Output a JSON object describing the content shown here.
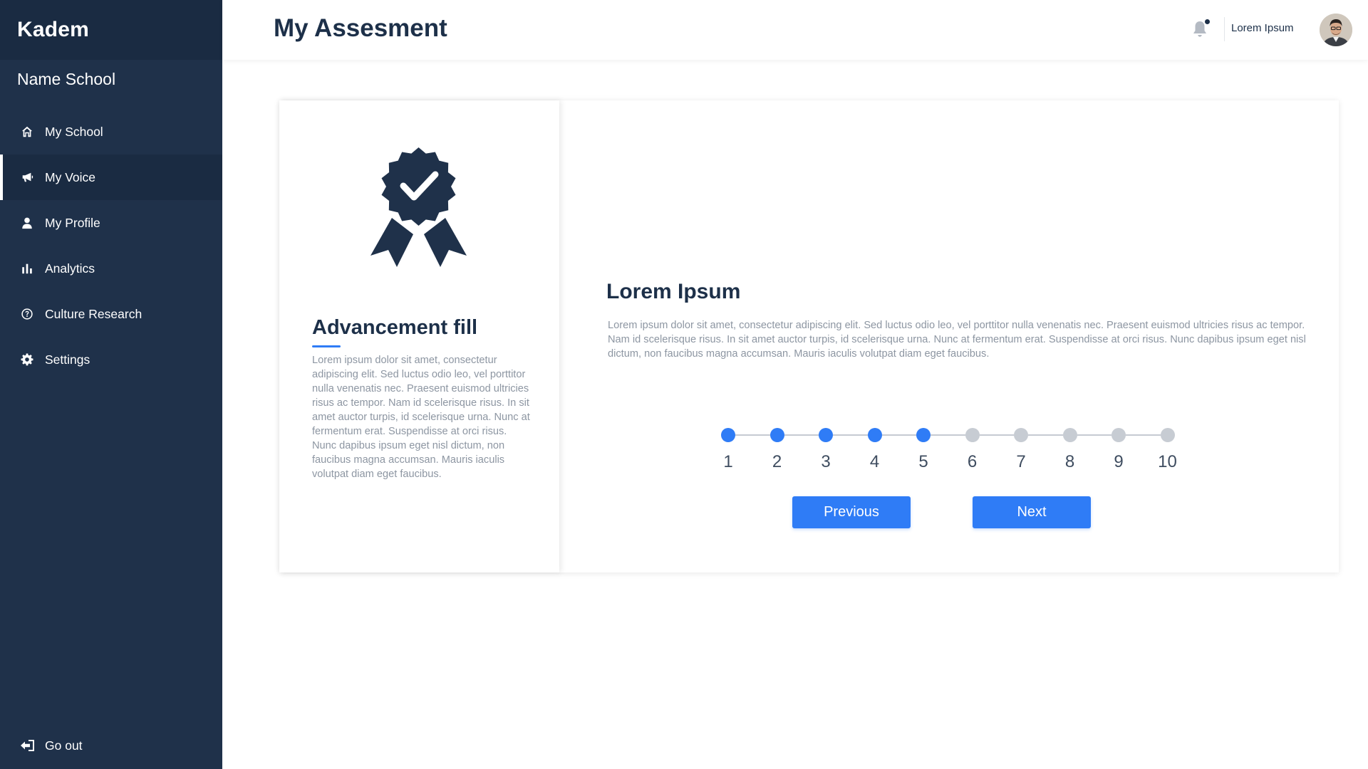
{
  "sidebar": {
    "brand": "Kadem",
    "school": "Name School",
    "items": [
      {
        "label": "My School",
        "icon": "home-icon",
        "active": false
      },
      {
        "label": "My Voice",
        "icon": "megaphone-icon",
        "active": true
      },
      {
        "label": "My Profile",
        "icon": "user-icon",
        "active": false
      },
      {
        "label": "Analytics",
        "icon": "bar-chart-icon",
        "active": false
      },
      {
        "label": "Culture Research",
        "icon": "question-circle-icon",
        "active": false
      },
      {
        "label": "Settings",
        "icon": "gear-icon",
        "active": false
      }
    ],
    "logout": {
      "label": "Go out",
      "icon": "logout-icon"
    }
  },
  "header": {
    "title": "My Assesment",
    "username": "Lorem Ipsum",
    "notification_icon": "bell-icon"
  },
  "left_panel": {
    "icon": "award-badge-check-icon",
    "title": "Advancement fill",
    "text": "Lorem ipsum dolor sit amet, consectetur adipiscing elit. Sed luctus odio leo, vel porttitor nulla venenatis nec. Praesent euismod ultricies risus ac tempor. Nam id scelerisque risus. In sit amet auctor turpis, id scelerisque urna. Nunc at fermentum erat. Suspendisse at orci risus. Nunc dapibus ipsum eget nisl dictum, non faucibus magna accumsan. Mauris iaculis volutpat diam eget faucibus."
  },
  "main": {
    "title": "Lorem Ipsum",
    "text": "Lorem ipsum dolor sit amet, consectetur adipiscing elit. Sed luctus odio leo, vel porttitor nulla venenatis nec. Praesent euismod ultricies risus ac tempor. Nam id scelerisque risus. In sit amet auctor turpis, id scelerisque urna. Nunc at fermentum erat. Suspendisse at orci risus. Nunc dapibus ipsum eget nisl dictum, non faucibus magna accumsan. Mauris iaculis volutpat diam eget faucibus."
  },
  "stepper": {
    "steps": [
      "1",
      "2",
      "3",
      "4",
      "5",
      "6",
      "7",
      "8",
      "9",
      "10"
    ],
    "completed": 5,
    "active_color": "#2f7cf6",
    "inactive_color": "#c7ccd3"
  },
  "buttons": {
    "previous": "Previous",
    "next": "Next"
  },
  "colors": {
    "sidebar": "#1f314a",
    "accent": "#2f7cf6",
    "title": "#1d3049"
  }
}
